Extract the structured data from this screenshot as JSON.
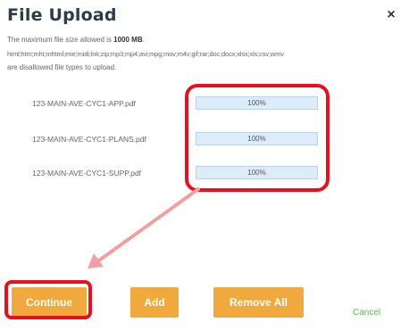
{
  "dialog": {
    "title": "File Upload",
    "close_symbol": "×"
  },
  "info": {
    "max_size_prefix": "The maximum file size allowed is ",
    "max_size_value": "1000 MB",
    "max_size_suffix": ".",
    "disallowed_types": "html;htm;mht;mhtml;exe;midi;lnk;zip;mp3;mp4;avi;mpg;mov;m4v;gif;rar;doc;docx;xlsx;xls;csv;wmv",
    "disallowed_suffix": "are disallowed file types to upload."
  },
  "files": [
    {
      "name": "123-MAIN-AVE-CYC1-APP.pdf",
      "progress_label": "100%",
      "progress": 1.0
    },
    {
      "name": "123-MAIN-AVE-CYC1-PLANS.pdf",
      "progress_label": "100%",
      "progress": 1.0
    },
    {
      "name": "123-MAIN-AVE-CYC1-SUPP.pdf",
      "progress_label": "100%",
      "progress": 1.0
    }
  ],
  "buttons": {
    "continue": "Continue",
    "add": "Add",
    "remove_all": "Remove All",
    "cancel": "Cancel"
  },
  "annotations": {
    "highlight_color": "#e8101c",
    "arrow_color": "#f0a0a0"
  },
  "colors": {
    "button": "#f0a93d",
    "cancel": "#5cb85c",
    "title": "#2d3a48"
  }
}
